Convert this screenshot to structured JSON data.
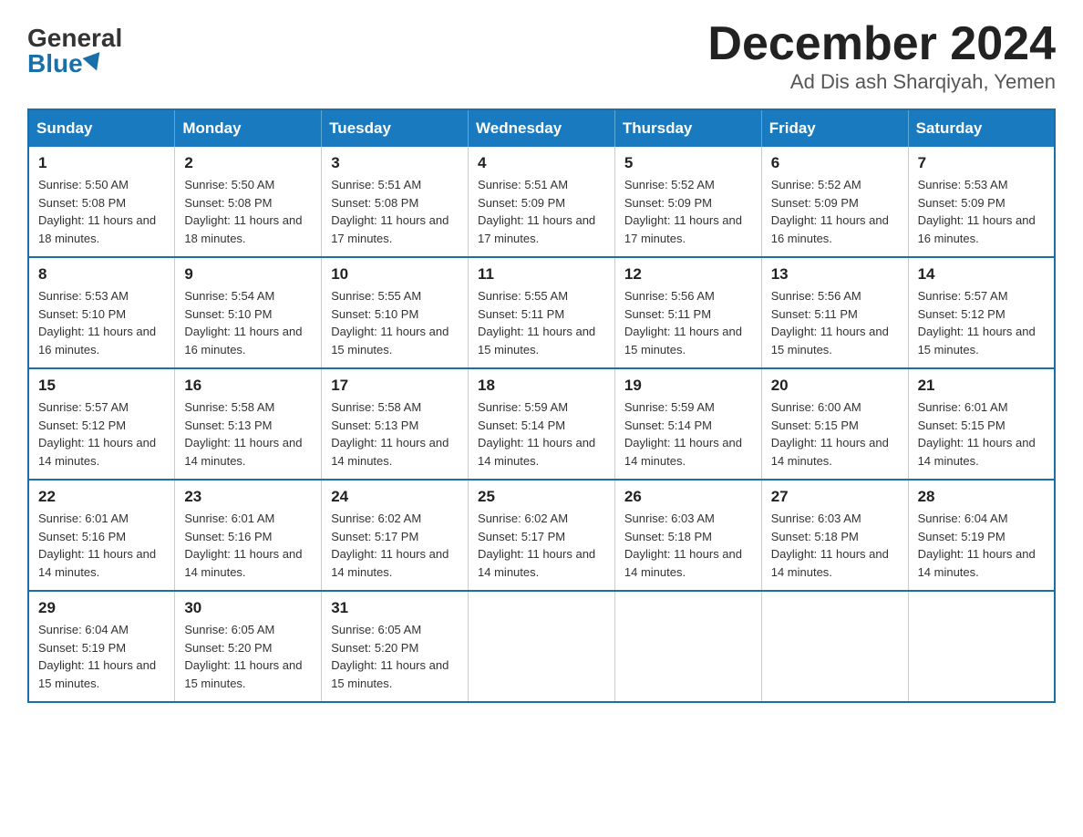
{
  "logo": {
    "general": "General",
    "blue": "Blue"
  },
  "title": "December 2024",
  "location": "Ad Dis ash Sharqiyah, Yemen",
  "days_of_week": [
    "Sunday",
    "Monday",
    "Tuesday",
    "Wednesday",
    "Thursday",
    "Friday",
    "Saturday"
  ],
  "weeks": [
    [
      {
        "day": "1",
        "sunrise": "5:50 AM",
        "sunset": "5:08 PM",
        "daylight": "11 hours and 18 minutes."
      },
      {
        "day": "2",
        "sunrise": "5:50 AM",
        "sunset": "5:08 PM",
        "daylight": "11 hours and 18 minutes."
      },
      {
        "day": "3",
        "sunrise": "5:51 AM",
        "sunset": "5:08 PM",
        "daylight": "11 hours and 17 minutes."
      },
      {
        "day": "4",
        "sunrise": "5:51 AM",
        "sunset": "5:09 PM",
        "daylight": "11 hours and 17 minutes."
      },
      {
        "day": "5",
        "sunrise": "5:52 AM",
        "sunset": "5:09 PM",
        "daylight": "11 hours and 17 minutes."
      },
      {
        "day": "6",
        "sunrise": "5:52 AM",
        "sunset": "5:09 PM",
        "daylight": "11 hours and 16 minutes."
      },
      {
        "day": "7",
        "sunrise": "5:53 AM",
        "sunset": "5:09 PM",
        "daylight": "11 hours and 16 minutes."
      }
    ],
    [
      {
        "day": "8",
        "sunrise": "5:53 AM",
        "sunset": "5:10 PM",
        "daylight": "11 hours and 16 minutes."
      },
      {
        "day": "9",
        "sunrise": "5:54 AM",
        "sunset": "5:10 PM",
        "daylight": "11 hours and 16 minutes."
      },
      {
        "day": "10",
        "sunrise": "5:55 AM",
        "sunset": "5:10 PM",
        "daylight": "11 hours and 15 minutes."
      },
      {
        "day": "11",
        "sunrise": "5:55 AM",
        "sunset": "5:11 PM",
        "daylight": "11 hours and 15 minutes."
      },
      {
        "day": "12",
        "sunrise": "5:56 AM",
        "sunset": "5:11 PM",
        "daylight": "11 hours and 15 minutes."
      },
      {
        "day": "13",
        "sunrise": "5:56 AM",
        "sunset": "5:11 PM",
        "daylight": "11 hours and 15 minutes."
      },
      {
        "day": "14",
        "sunrise": "5:57 AM",
        "sunset": "5:12 PM",
        "daylight": "11 hours and 15 minutes."
      }
    ],
    [
      {
        "day": "15",
        "sunrise": "5:57 AM",
        "sunset": "5:12 PM",
        "daylight": "11 hours and 14 minutes."
      },
      {
        "day": "16",
        "sunrise": "5:58 AM",
        "sunset": "5:13 PM",
        "daylight": "11 hours and 14 minutes."
      },
      {
        "day": "17",
        "sunrise": "5:58 AM",
        "sunset": "5:13 PM",
        "daylight": "11 hours and 14 minutes."
      },
      {
        "day": "18",
        "sunrise": "5:59 AM",
        "sunset": "5:14 PM",
        "daylight": "11 hours and 14 minutes."
      },
      {
        "day": "19",
        "sunrise": "5:59 AM",
        "sunset": "5:14 PM",
        "daylight": "11 hours and 14 minutes."
      },
      {
        "day": "20",
        "sunrise": "6:00 AM",
        "sunset": "5:15 PM",
        "daylight": "11 hours and 14 minutes."
      },
      {
        "day": "21",
        "sunrise": "6:01 AM",
        "sunset": "5:15 PM",
        "daylight": "11 hours and 14 minutes."
      }
    ],
    [
      {
        "day": "22",
        "sunrise": "6:01 AM",
        "sunset": "5:16 PM",
        "daylight": "11 hours and 14 minutes."
      },
      {
        "day": "23",
        "sunrise": "6:01 AM",
        "sunset": "5:16 PM",
        "daylight": "11 hours and 14 minutes."
      },
      {
        "day": "24",
        "sunrise": "6:02 AM",
        "sunset": "5:17 PM",
        "daylight": "11 hours and 14 minutes."
      },
      {
        "day": "25",
        "sunrise": "6:02 AM",
        "sunset": "5:17 PM",
        "daylight": "11 hours and 14 minutes."
      },
      {
        "day": "26",
        "sunrise": "6:03 AM",
        "sunset": "5:18 PM",
        "daylight": "11 hours and 14 minutes."
      },
      {
        "day": "27",
        "sunrise": "6:03 AM",
        "sunset": "5:18 PM",
        "daylight": "11 hours and 14 minutes."
      },
      {
        "day": "28",
        "sunrise": "6:04 AM",
        "sunset": "5:19 PM",
        "daylight": "11 hours and 14 minutes."
      }
    ],
    [
      {
        "day": "29",
        "sunrise": "6:04 AM",
        "sunset": "5:19 PM",
        "daylight": "11 hours and 15 minutes."
      },
      {
        "day": "30",
        "sunrise": "6:05 AM",
        "sunset": "5:20 PM",
        "daylight": "11 hours and 15 minutes."
      },
      {
        "day": "31",
        "sunrise": "6:05 AM",
        "sunset": "5:20 PM",
        "daylight": "11 hours and 15 minutes."
      },
      null,
      null,
      null,
      null
    ]
  ],
  "labels": {
    "sunrise": "Sunrise:",
    "sunset": "Sunset:",
    "daylight": "Daylight:"
  }
}
